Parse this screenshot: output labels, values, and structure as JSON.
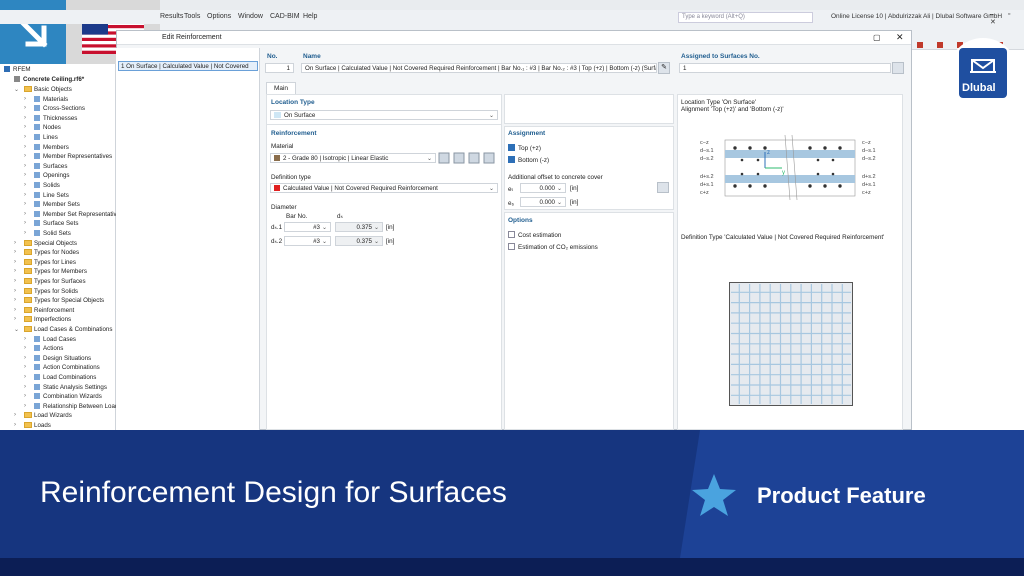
{
  "menu": {
    "items": [
      "Results",
      "Tools",
      "Options",
      "Window",
      "CAD-BIM",
      "Help"
    ]
  },
  "search": {
    "placeholder": "Type a keyword (Alt+Q)"
  },
  "license": "Online License 10 | Abdulrizzak Ali | Dlubal Software GmbH",
  "dialog": {
    "title": "Edit Reinforcement",
    "list_item": "1  On Surface | Calculated Value | Not Covered"
  },
  "no": {
    "label": "No.",
    "value": "1"
  },
  "name": {
    "label": "Name",
    "value": "On Surface | Calculated Value | Not Covered Required Reinforcement | Bar No.₁ : #3 | Bar No.₂ : #3 | Top (+z) | Bottom (-z) (Surfac"
  },
  "assigned": {
    "label": "Assigned to Surfaces No.",
    "value": "1"
  },
  "tab": "Main",
  "location_type": {
    "header": "Location Type",
    "value": "On Surface"
  },
  "reinforcement": {
    "header": "Reinforcement",
    "material_label": "Material",
    "material_value": "2 - Grade 80 | Isotropic | Linear Elastic",
    "deftype_label": "Definition type",
    "deftype_value": "Calculated Value | Not Covered Required Reinforcement"
  },
  "diameter": {
    "header": "Diameter",
    "col_bar": "Bar No.",
    "col_d": "dₛ",
    "rows": [
      {
        "label": "dₛ.1",
        "bar": "#3",
        "value": "0.375",
        "unit": "[in]"
      },
      {
        "label": "dₛ.2",
        "bar": "#3",
        "value": "0.375",
        "unit": "[in]"
      }
    ]
  },
  "assignment": {
    "header": "Assignment",
    "top": "Top (+z)",
    "bottom": "Bottom (-z)",
    "offset_header": "Additional offset to concrete cover",
    "offsets": [
      {
        "label": "eₜ",
        "value": "0.000",
        "unit": "[in]"
      },
      {
        "label": "e₆",
        "value": "0.000",
        "unit": "[in]"
      }
    ]
  },
  "options": {
    "header": "Options",
    "cost": "Cost estimation",
    "co2": "Estimation of CO₂ emissions"
  },
  "diagram": {
    "caption1": "Location Type 'On Surface'",
    "caption2": "Alignment 'Top (+z)' and 'Bottom (-z)'",
    "left_labels": [
      "c−z",
      "d−s.1",
      "d−s.2",
      "d+s.2",
      "d+s.1",
      "c+z"
    ],
    "right_labels": [
      "c−z",
      "d−s.1",
      "d−s.2",
      "d+s.2",
      "d+s.1",
      "c+z"
    ],
    "axis_z": "z",
    "axis_y": "y"
  },
  "deftype_caption": "Definition Type 'Calculated Value | Not Covered Required Reinforcement'",
  "tree": {
    "root": "RFEM",
    "model": "Concrete Ceiling.rf6*",
    "items": [
      {
        "level": 1,
        "label": "Basic Objects",
        "type": "folder"
      },
      {
        "level": 2,
        "label": "Materials",
        "type": "item"
      },
      {
        "level": 2,
        "label": "Cross-Sections",
        "type": "item"
      },
      {
        "level": 2,
        "label": "Thicknesses",
        "type": "item"
      },
      {
        "level": 2,
        "label": "Nodes",
        "type": "item"
      },
      {
        "level": 2,
        "label": "Lines",
        "type": "item"
      },
      {
        "level": 2,
        "label": "Members",
        "type": "item"
      },
      {
        "level": 2,
        "label": "Member Representatives",
        "type": "item"
      },
      {
        "level": 2,
        "label": "Surfaces",
        "type": "item"
      },
      {
        "level": 2,
        "label": "Openings",
        "type": "item"
      },
      {
        "level": 2,
        "label": "Solids",
        "type": "item"
      },
      {
        "level": 2,
        "label": "Line Sets",
        "type": "item"
      },
      {
        "level": 2,
        "label": "Member Sets",
        "type": "item"
      },
      {
        "level": 2,
        "label": "Member Set Representatives",
        "type": "item"
      },
      {
        "level": 2,
        "label": "Surface Sets",
        "type": "item"
      },
      {
        "level": 2,
        "label": "Solid Sets",
        "type": "item"
      },
      {
        "level": 1,
        "label": "Special Objects",
        "type": "folder"
      },
      {
        "level": 1,
        "label": "Types for Nodes",
        "type": "folder"
      },
      {
        "level": 1,
        "label": "Types for Lines",
        "type": "folder"
      },
      {
        "level": 1,
        "label": "Types for Members",
        "type": "folder"
      },
      {
        "level": 1,
        "label": "Types for Surfaces",
        "type": "folder"
      },
      {
        "level": 1,
        "label": "Types for Solids",
        "type": "folder"
      },
      {
        "level": 1,
        "label": "Types for Special Objects",
        "type": "folder"
      },
      {
        "level": 1,
        "label": "Reinforcement",
        "type": "folder"
      },
      {
        "level": 1,
        "label": "Imperfections",
        "type": "folder"
      },
      {
        "level": 1,
        "label": "Load Cases & Combinations",
        "type": "folder"
      },
      {
        "level": 2,
        "label": "Load Cases",
        "type": "item"
      },
      {
        "level": 2,
        "label": "Actions",
        "type": "item"
      },
      {
        "level": 2,
        "label": "Design Situations",
        "type": "item"
      },
      {
        "level": 2,
        "label": "Action Combinations",
        "type": "item"
      },
      {
        "level": 2,
        "label": "Load Combinations",
        "type": "item"
      },
      {
        "level": 2,
        "label": "Static Analysis Settings",
        "type": "item"
      },
      {
        "level": 2,
        "label": "Combination Wizards",
        "type": "item"
      },
      {
        "level": 2,
        "label": "Relationship Between Load Cases",
        "type": "item"
      },
      {
        "level": 1,
        "label": "Load Wizards",
        "type": "folder"
      },
      {
        "level": 1,
        "label": "Loads",
        "type": "folder"
      }
    ]
  },
  "banner": {
    "title": "Reinforcement Design for Surfaces",
    "badge": "Product Feature"
  },
  "logo": "Dlubal",
  "colors": {
    "banner": "#16357f",
    "accent": "#2e86c1",
    "material": "#8a6d4b",
    "deftype": "#e02020"
  }
}
